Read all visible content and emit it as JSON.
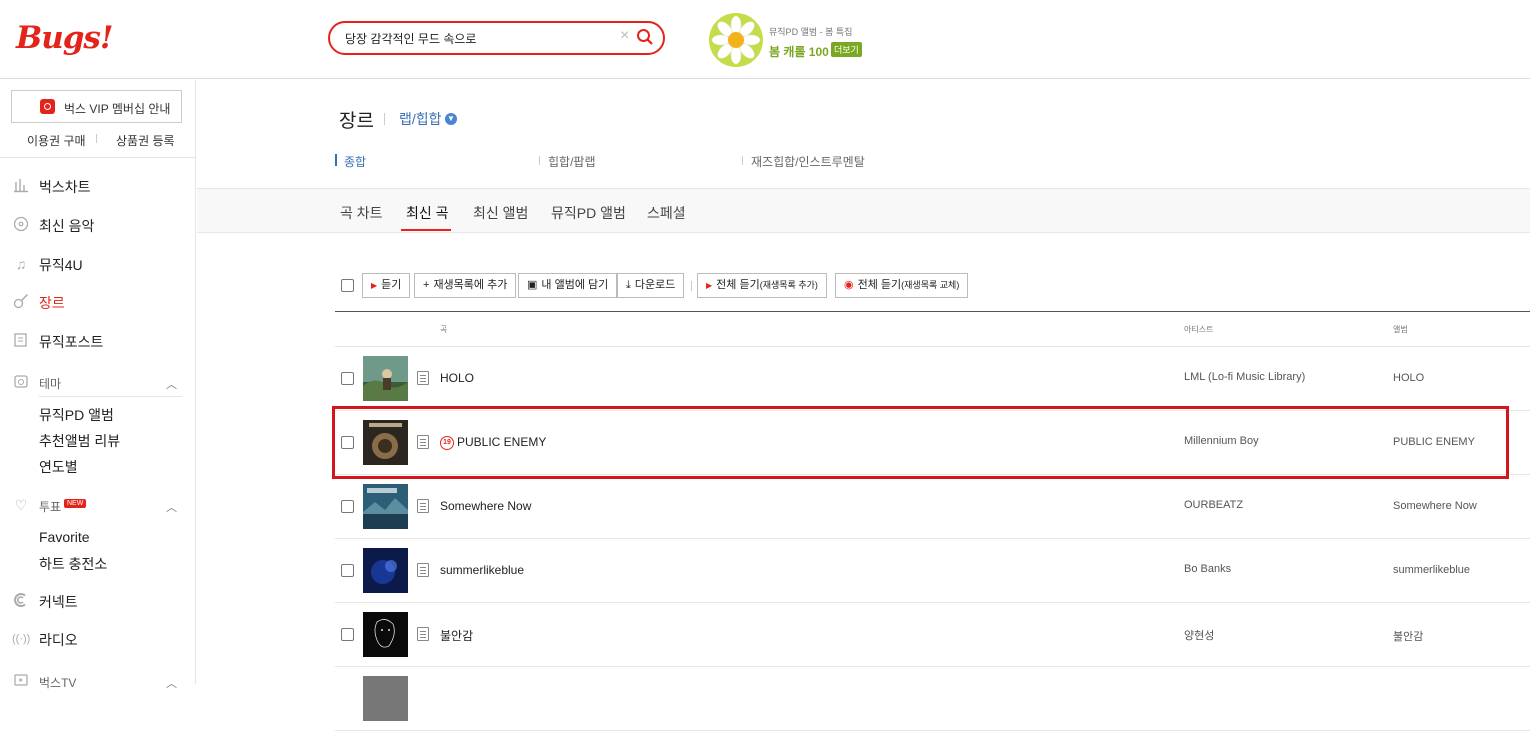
{
  "header": {
    "logo": "Bugs!",
    "search_value": "당장 감각적인 무드 속으로",
    "promo_sub": "뮤직PD 앨범 - 봄 특집",
    "promo_main": "봄 캐롤 100",
    "promo_more": "더보기"
  },
  "sidebar": {
    "vip_label": "벅스 VIP 멤버십 안내",
    "buy_pass": "이용권 구매",
    "register_coupon": "상품권 등록",
    "items": [
      {
        "label": "벅스차트",
        "icon": "chart-icon"
      },
      {
        "label": "최신 음악",
        "icon": "disc-icon"
      },
      {
        "label": "뮤직4U",
        "icon": "music-note-icon"
      },
      {
        "label": "장르",
        "icon": "guitar-icon"
      },
      {
        "label": "뮤직포스트",
        "icon": "post-icon"
      },
      {
        "label": "테마",
        "icon": "theme-icon"
      },
      {
        "label": "투표",
        "icon": "heart-icon"
      },
      {
        "label": "커넥트",
        "icon": "connect-icon"
      },
      {
        "label": "라디오",
        "icon": "radio-icon"
      },
      {
        "label": "벅스TV",
        "icon": "tv-icon"
      }
    ],
    "theme_sub": [
      "뮤직PD 앨범",
      "추천앨범 리뷰",
      "연도별"
    ],
    "vote_new": "NEW",
    "vote_sub": [
      "Favorite",
      "하트 충전소"
    ]
  },
  "main": {
    "genre_title": "장르",
    "genre_selected": "랩/힙합",
    "subgenres": [
      "종합",
      "힙합/팝랩",
      "재즈힙합/인스트루멘탈"
    ],
    "tabs": [
      "곡 차트",
      "최신 곡",
      "최신 앨범",
      "뮤직PD 앨범",
      "스페셜"
    ],
    "toolbar": {
      "listen": "듣기",
      "add_playlist": "재생목록에 추가",
      "add_album": "내 앨범에 담기",
      "download": "다운로드",
      "listen_all_add": "전체 듣기",
      "listen_all_add_note": "(재생목록 추가)",
      "listen_all_replace": "전체 듣기",
      "listen_all_replace_note": "(재생목록 교체)"
    },
    "columns": {
      "song": "곡",
      "artist": "아티스트",
      "album": "앨범"
    },
    "rows": [
      {
        "title": "HOLO",
        "artist": "LML (Lo-fi Music Library)",
        "album": "HOLO",
        "age": ""
      },
      {
        "title": "PUBLIC ENEMY",
        "artist": "Millennium Boy",
        "album": "PUBLIC ENEMY",
        "age": "19"
      },
      {
        "title": "Somewhere Now",
        "artist": "OURBEATZ",
        "album": "Somewhere Now",
        "age": ""
      },
      {
        "title": "summerlikeblue",
        "artist": "Bo Banks",
        "album": "summerlikeblue",
        "age": ""
      },
      {
        "title": "불안감",
        "artist": "양현성",
        "album": "불안감",
        "age": ""
      }
    ]
  },
  "colors": {
    "brand": "#e4241b",
    "link": "#3a6fb5",
    "highlight": "#d6141c"
  }
}
